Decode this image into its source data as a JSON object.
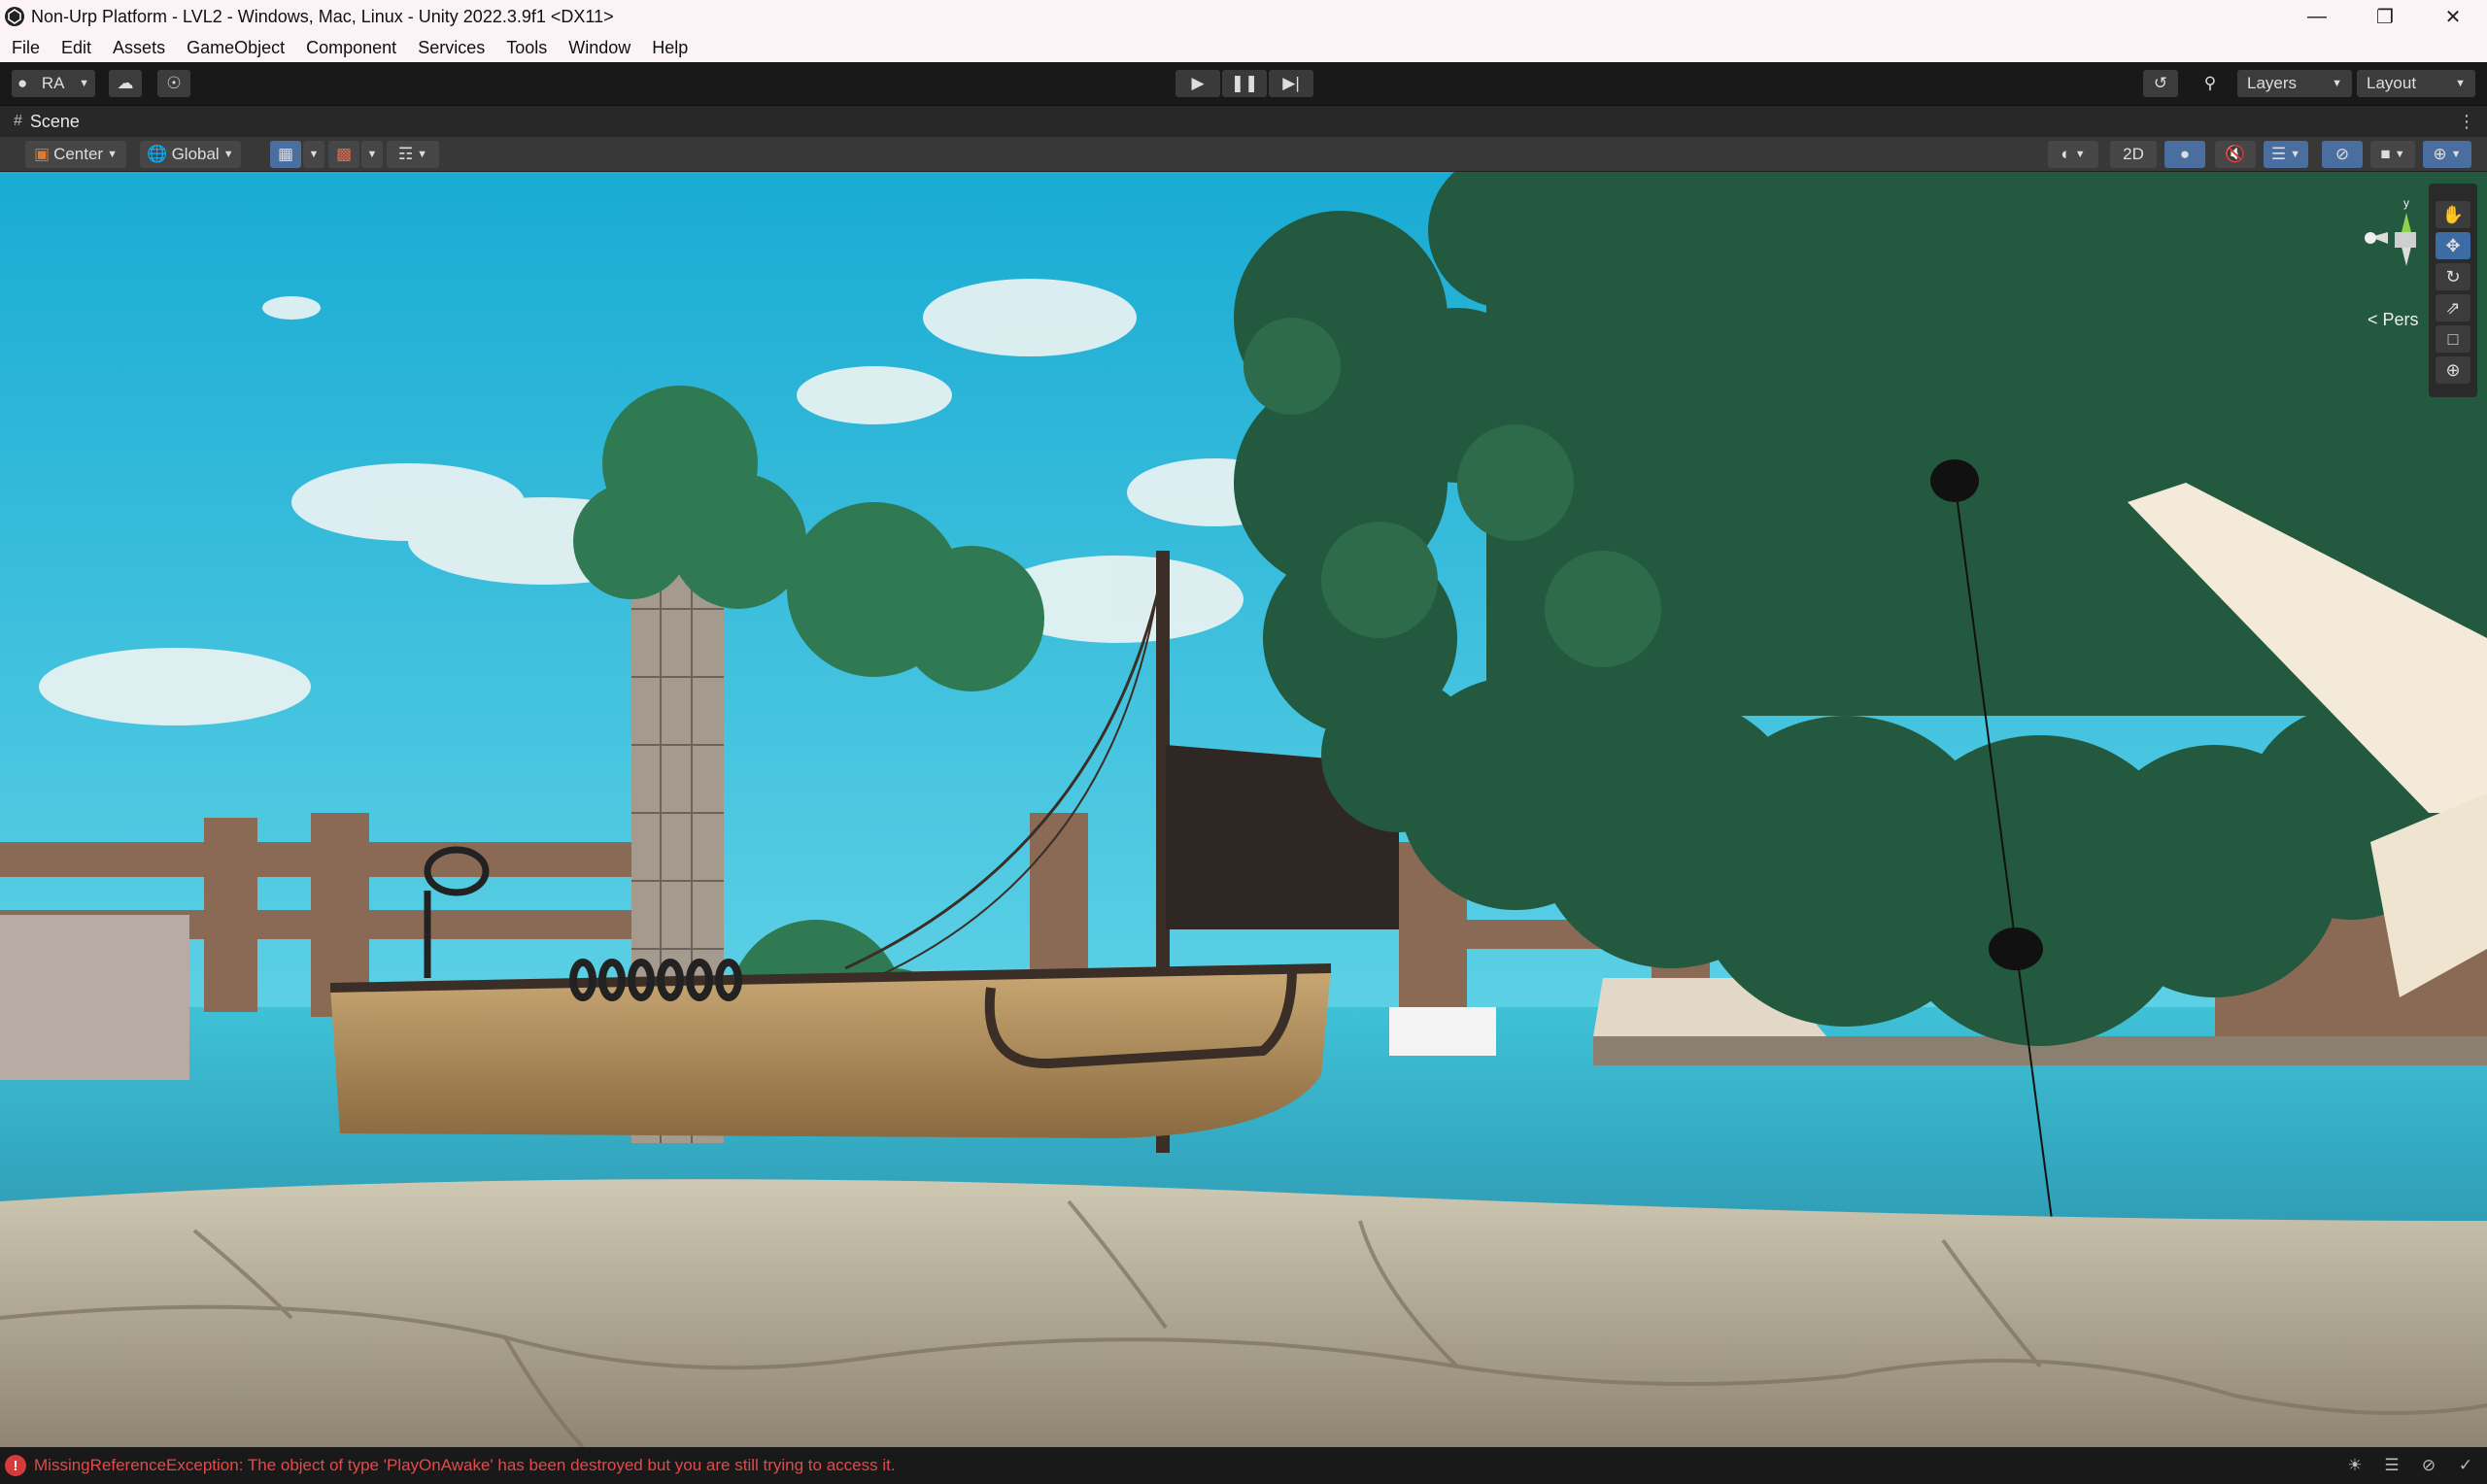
{
  "window": {
    "title": "Non-Urp Platform - LVL2 - Windows, Mac, Linux - Unity 2022.3.9f1 <DX11>",
    "minimize_icon": "minimize-icon",
    "restore_icon": "restore-icon",
    "close_icon": "close-icon"
  },
  "menu": {
    "items": [
      "File",
      "Edit",
      "Assets",
      "GameObject",
      "Component",
      "Services",
      "Tools",
      "Window",
      "Help"
    ]
  },
  "toolbar": {
    "account_label": "RA",
    "layers_label": "Layers",
    "layout_label": "Layout"
  },
  "scene_tab": {
    "label": "Scene"
  },
  "scene_toolbar": {
    "pivot_label": "Center",
    "space_label": "Global",
    "mode_2d_label": "2D"
  },
  "viewport": {
    "projection_label": "Pers",
    "gizmo_axis_label": "y",
    "colors": {
      "sky": "#1ab3d6",
      "water": "#3fb6cf",
      "foliage": "#23593f",
      "ground": "#a59e88"
    }
  },
  "status": {
    "error_text": "MissingReferenceException: The object of type 'PlayOnAwake' has been destroyed but you are still trying to access it.",
    "error_color": "#e24a4a"
  }
}
